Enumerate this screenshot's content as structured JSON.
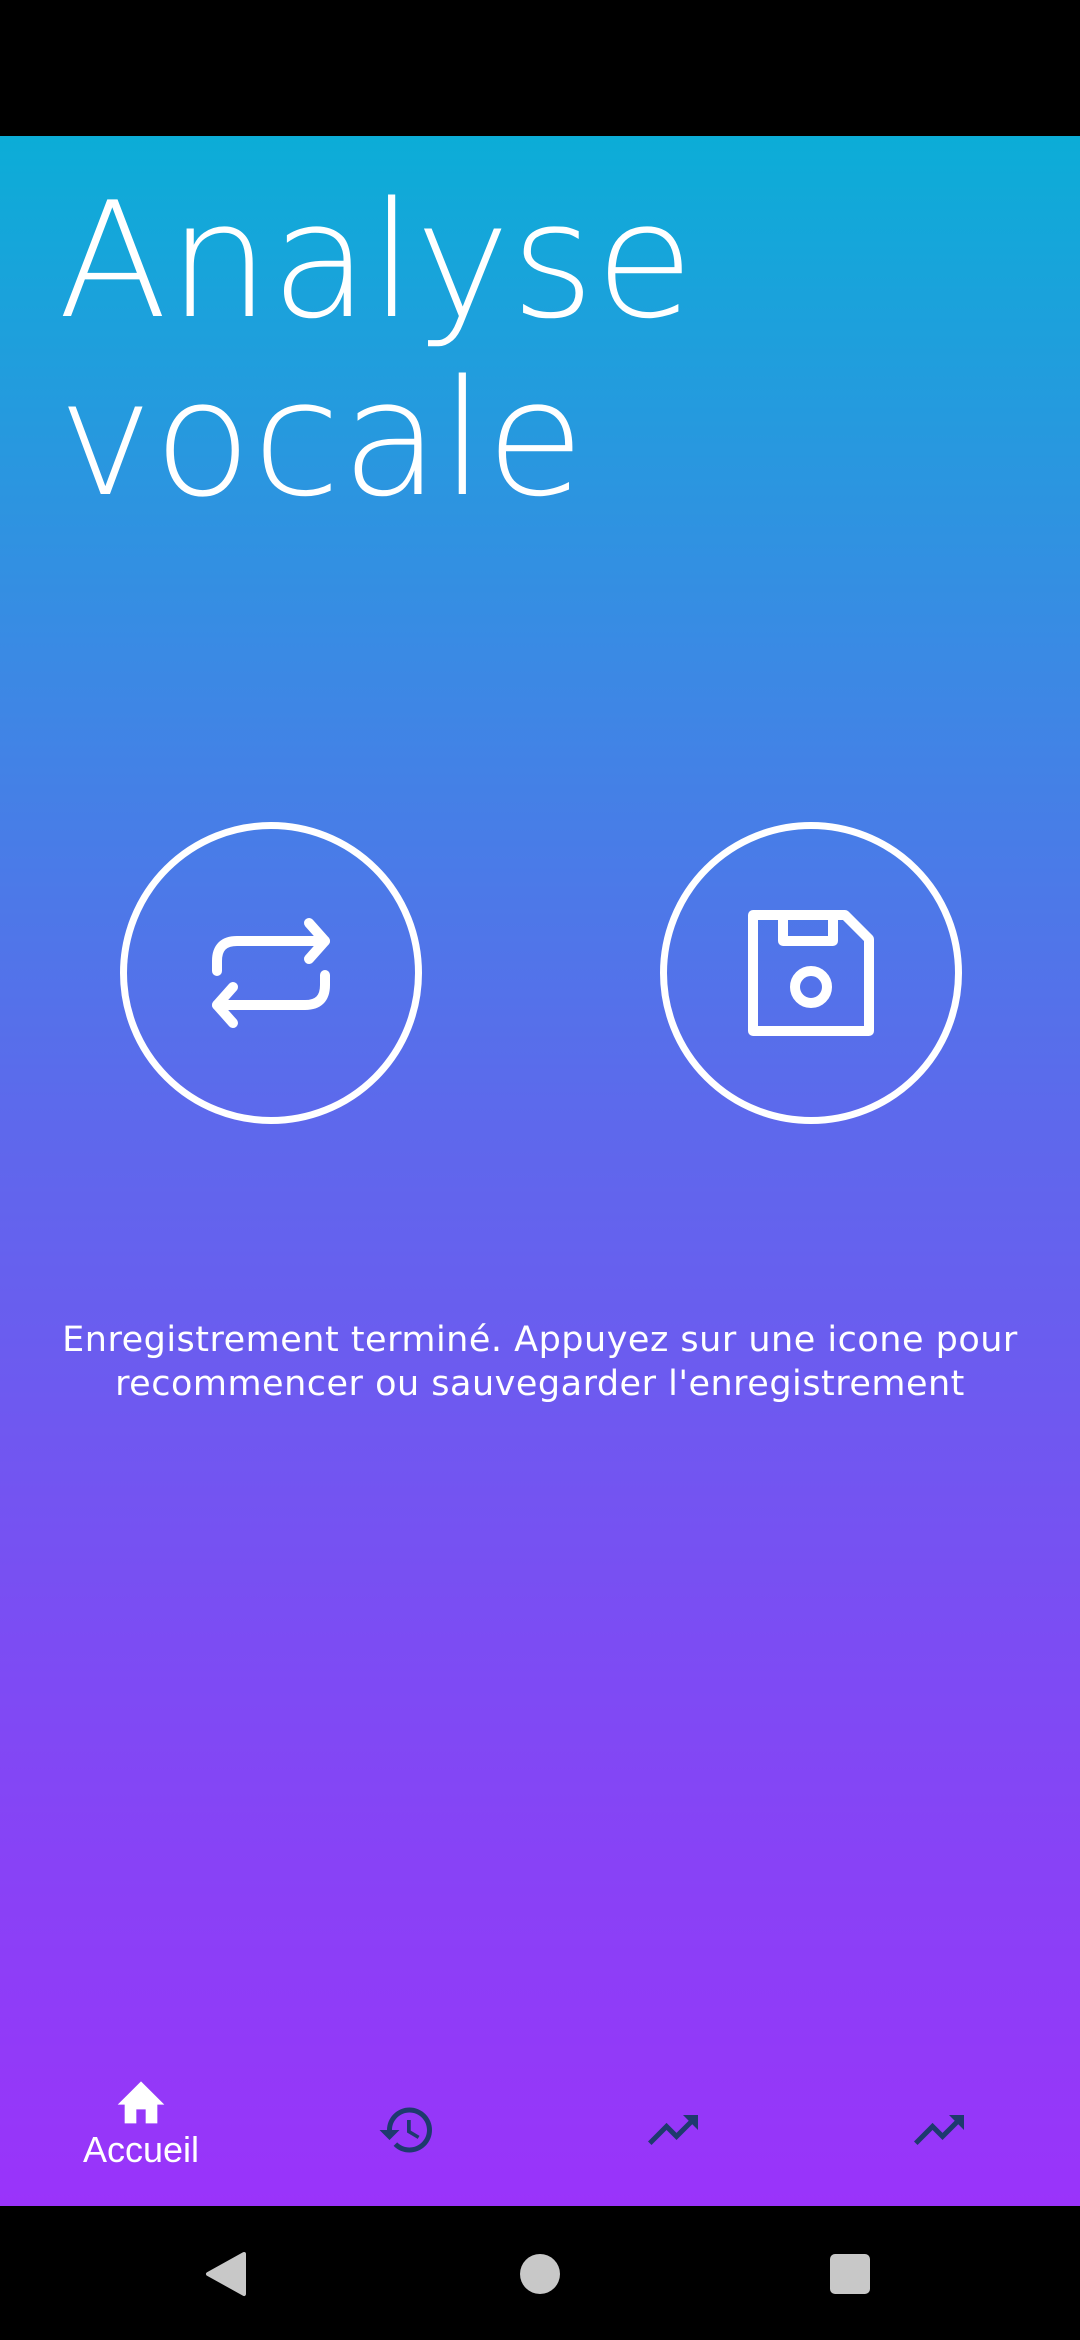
{
  "page": {
    "title": "Analyse vocale",
    "message": "Enregistrement terminé. Appuyez sur une icone pour recommencer ou sauvegarder l'enregistrement"
  },
  "actions": [
    {
      "name": "restart",
      "icon": "repeat-icon"
    },
    {
      "name": "save",
      "icon": "floppy-disk-icon"
    }
  ],
  "bottom_nav": {
    "items": [
      {
        "id": "home",
        "label": "Accueil",
        "icon": "home-icon",
        "active": true
      },
      {
        "id": "history",
        "label": "",
        "icon": "history-icon",
        "active": false
      },
      {
        "id": "trends-1",
        "label": "",
        "icon": "trending-up-icon",
        "active": false
      },
      {
        "id": "trends-2",
        "label": "",
        "icon": "trending-up-icon",
        "active": false
      }
    ]
  },
  "system_nav": [
    "back-icon",
    "home-circle-icon",
    "recents-square-icon"
  ],
  "colors": {
    "gradient_top": "#0cadd7",
    "gradient_bottom": "#9a33fa",
    "text": "#ffffff",
    "inactive_icon": "#1e3a6e"
  }
}
